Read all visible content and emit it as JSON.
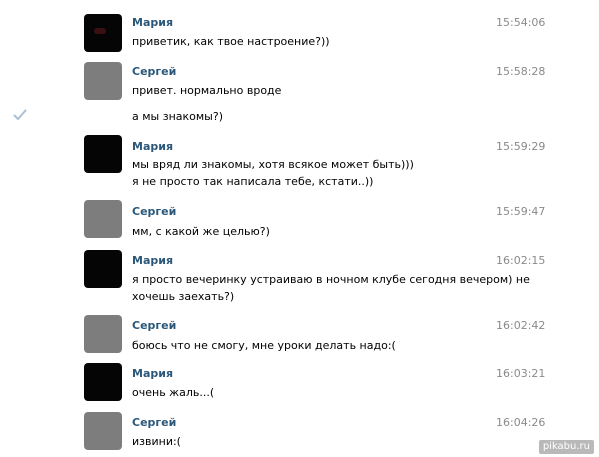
{
  "messages": [
    {
      "author": "Мария",
      "time": "15:54:06",
      "avatar": "dark",
      "lines": [
        "приветик, как твое настроение?))"
      ]
    },
    {
      "author": "Сергей",
      "time": "15:58:28",
      "avatar": "gray",
      "lines": [
        "привет. нормально вроде"
      ],
      "extra_line": "а мы знакомы?)",
      "extra_status_icon": "read-check-icon"
    },
    {
      "author": "Мария",
      "time": "15:59:29",
      "avatar": "dark",
      "lines": [
        "мы вряд ли знакомы, хотя всякое может быть)))",
        "я не просто так написала тебе, кстати..))"
      ]
    },
    {
      "author": "Сергей",
      "time": "15:59:47",
      "avatar": "gray",
      "lines": [
        "мм, с какой же целью?)"
      ]
    },
    {
      "author": "Мария",
      "time": "16:02:15",
      "avatar": "dark",
      "lines": [
        "я просто вечеринку устраиваю в ночном клубе сегодня вечером) не",
        "хочешь заехать?)"
      ]
    },
    {
      "author": "Сергей",
      "time": "16:02:42",
      "avatar": "gray",
      "lines": [
        "боюсь что не смогу, мне уроки делать надо:("
      ]
    },
    {
      "author": "Мария",
      "time": "16:03:21",
      "avatar": "dark",
      "lines": [
        "очень жаль...("
      ]
    },
    {
      "author": "Сергей",
      "time": "16:04:26",
      "avatar": "gray",
      "lines": [
        "извини:("
      ]
    }
  ],
  "watermark": "pikabu.ru",
  "colors": {
    "author_name": "#2b587a",
    "timestamp": "#8a8a8a",
    "dark_avatar": "#050505",
    "gray_avatar": "#7d7d7d",
    "check_icon": "#a9bfd3"
  }
}
